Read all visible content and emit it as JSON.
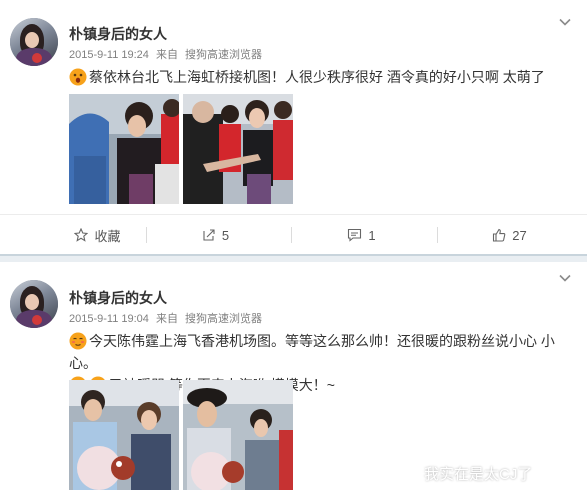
{
  "posts": [
    {
      "username": "朴镇身后的女人",
      "time": "2015-9-11 19:24",
      "source_prefix": "来自",
      "source": "搜狗高速浏览器",
      "text": "蔡依林台北飞上海虹桥接机图！人很少秩序很好 酒令真的好小只啊 太萌了",
      "emoji": "surprised-emoji",
      "actions": {
        "favorite_label": "收藏",
        "repost_count": "5",
        "comment_count": "1",
        "like_count": "27"
      }
    },
    {
      "username": "朴镇身后的女人",
      "time": "2015-9-11 19:04",
      "source_prefix": "来自",
      "source": "搜狗高速浏览器",
      "text_line1": "今天陈伟霆上海飞香港机场图。等等这么那么帅！还很暖的跟粉丝说小心 小",
      "text_line2": "心。",
      "text_line3": "已被暖哭 等你再来上海哟 摸摸大！~",
      "emoji": [
        "embarrassed-emoji",
        "crying-emoji",
        "crying-emoji"
      ]
    }
  ],
  "watermark": {
    "text": "我实在是太CJ了",
    "icon": "wechat-icon"
  },
  "colors": {
    "username": "#333333",
    "meta": "#808080",
    "separator": "#e9eef2",
    "emoji": "#f7a21b"
  }
}
